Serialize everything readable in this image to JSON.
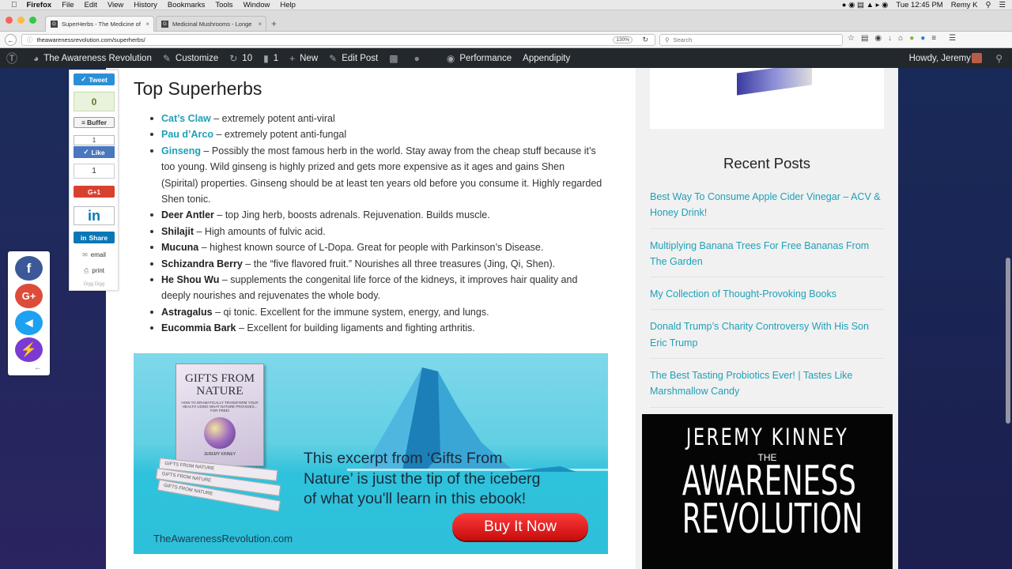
{
  "menubar": {
    "app": "Firefox",
    "items": [
      "File",
      "Edit",
      "View",
      "History",
      "Bookmarks",
      "Tools",
      "Window",
      "Help"
    ],
    "clock": "Tue 12:45 PM",
    "user": "Remy K"
  },
  "tabs": [
    {
      "title": "SuperHerbs - The Medicine of",
      "active": true
    },
    {
      "title": "Medicinal Mushrooms - Longe",
      "active": false
    }
  ],
  "urlbar": {
    "url": "theawarenessrevolution.com/superherbs/",
    "zoom": "130%",
    "search_placeholder": "Search"
  },
  "wpbar": {
    "site": "The Awareness Revolution",
    "customize": "Customize",
    "updates": "10",
    "comments": "1",
    "new": "New",
    "edit": "Edit Post",
    "performance": "Performance",
    "appendipity": "Appendipity",
    "howdy": "Howdy, Jeremy"
  },
  "share": {
    "tweet": "Tweet",
    "count": "0",
    "buffer": "Buffer",
    "fb_count": "1",
    "like": "Like",
    "gplus_count": "1",
    "gplus": "G+1",
    "linkedin": "in",
    "share": "Share",
    "email": "email",
    "print": "print",
    "digg": "Digg Digg"
  },
  "main": {
    "heading": "Top Superherbs",
    "herbs": [
      {
        "name": "Cat’s Claw",
        "link": true,
        "desc": " – extremely potent anti-viral"
      },
      {
        "name": "Pau d’Arco",
        "link": true,
        "desc": " – extremely potent anti-fungal"
      },
      {
        "name": "Ginseng",
        "link": true,
        "desc": " – Possibly the most famous herb in the world. Stay away from the cheap stuff because it’s too young. Wild ginseng is highly prized and gets more expensive as it ages and gains Shen (Spirital) properties. Ginseng should be at least ten years old before you consume it. Highly regarded Shen tonic."
      },
      {
        "name": "Deer Antler",
        "link": false,
        "desc": " – top Jing herb, boosts adrenals. Rejuvenation. Builds muscle."
      },
      {
        "name": "Shilajit",
        "link": false,
        "desc": " – High amounts of fulvic acid."
      },
      {
        "name": "Mucuna",
        "link": false,
        "desc": " – highest known source of L-Dopa. Great for people with Parkinson’s Disease."
      },
      {
        "name": "Schizandra Berry",
        "link": false,
        "desc": " – the “five flavored fruit.” Nourishes all three treasures (Jing, Qi, Shen)."
      },
      {
        "name": "He Shou Wu",
        "link": false,
        "desc": " – supplements the congenital life force of the kidneys, it improves hair quality and deeply nourishes and rejuvenates the whole body."
      },
      {
        "name": "Astragalus",
        "link": false,
        "desc": " – qi tonic. Excellent for the immune system, energy, and lungs."
      },
      {
        "name": "Eucommia Bark",
        "link": false,
        "desc": " – Excellent for building ligaments and fighting arthritis."
      }
    ],
    "banner": {
      "book_title": "GIFTS FROM NATURE",
      "book_sub": "HOW TO DRAMATICALLY TRANSFORM YOUR HEALTH USING WHAT NATURE PROVIDES... FOR FREE!",
      "book_author": "JEREMY KINNEY",
      "stack_label": "GIFTS FROM NATURE",
      "promo_line1": "This excerpt from ‘Gifts From",
      "promo_line2": "Nature’ is just the tip of the iceberg",
      "promo_line3": "of what you'll learn in this ebook!",
      "button": "Buy It Now",
      "site": "TheAwarenessRevolution.com"
    }
  },
  "sidebar": {
    "recent_title": "Recent Posts",
    "posts": [
      "Best Way To Consume Apple Cider Vinegar – ACV & Honey Drink!",
      "Multiplying Banana Trees For Free Bananas From The Garden",
      "My Collection of Thought-Provoking Books",
      "Donald Trump’s Charity Controversy With His Son Eric Trump",
      "The Best Tasting Probiotics Ever! | Tastes Like Marshmallow Candy"
    ],
    "ad_author": "JEREMY KINNEY",
    "ad_the": "THE",
    "ad_title1": "AWARENESS",
    "ad_title2": "REVOLUTION"
  },
  "colors": {
    "link": "#1fa0b7",
    "wpbar": "#23282d",
    "buy": "#e01818"
  }
}
